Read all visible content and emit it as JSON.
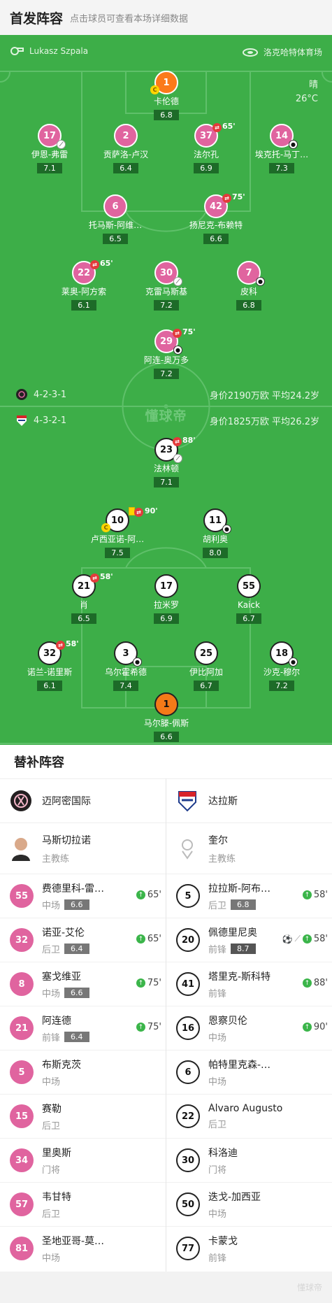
{
  "header": {
    "title": "首发阵容",
    "subtitle": "点击球员可查看本场详细数据"
  },
  "match": {
    "referee": "Lukasz Szpala",
    "venue": "洛克哈特体育场",
    "weather": "晴",
    "temp": "26°C"
  },
  "home": {
    "formation": "4-2-3-1",
    "value_text": "身价2190万欧 平均24.2岁"
  },
  "away": {
    "formation": "4-3-2-1",
    "value_text": "身价1825万欧 平均26.2岁"
  },
  "watermark": "懂球帝",
  "pitch_players": [
    {
      "num": "1",
      "name": "卡伦德",
      "rating": "6.8",
      "cap": "C"
    },
    {
      "num": "17",
      "name": "伊恩-弗雷",
      "rating": "7.1"
    },
    {
      "num": "2",
      "name": "贡萨洛-卢汉",
      "rating": "6.4"
    },
    {
      "num": "37",
      "name": "法尔孔",
      "rating": "6.9",
      "min": "65'"
    },
    {
      "num": "14",
      "name": "埃克托-马丁…",
      "rating": "7.3"
    },
    {
      "num": "6",
      "name": "托马斯-阿维…",
      "rating": "6.5"
    },
    {
      "num": "42",
      "name": "扬尼克-布赖特",
      "rating": "6.6",
      "min": "75'"
    },
    {
      "num": "22",
      "name": "莱奥-阿方索",
      "rating": "6.1",
      "min": "65'"
    },
    {
      "num": "30",
      "name": "克雷马斯基",
      "rating": "7.2"
    },
    {
      "num": "7",
      "name": "皮科",
      "rating": "6.8"
    },
    {
      "num": "29",
      "name": "阿连-奥万多",
      "rating": "7.2",
      "min": "75'"
    },
    {
      "num": "23",
      "name": "法林顿",
      "rating": "7.1",
      "min": "88'"
    },
    {
      "num": "10",
      "name": "卢西亚诺-阿…",
      "rating": "7.5",
      "min": "90'",
      "cap": "C"
    },
    {
      "num": "11",
      "name": "胡利奥",
      "rating": "8.0"
    },
    {
      "num": "21",
      "name": "肖",
      "rating": "6.5",
      "min": "58'"
    },
    {
      "num": "17",
      "name": "拉米罗",
      "rating": "6.9"
    },
    {
      "num": "55",
      "name": "Kaick",
      "rating": "6.7"
    },
    {
      "num": "32",
      "name": "诺兰-诺里斯",
      "rating": "6.1",
      "min": "58'"
    },
    {
      "num": "3",
      "name": "乌尔霍希德",
      "rating": "7.4"
    },
    {
      "num": "25",
      "name": "伊比阿加",
      "rating": "6.7"
    },
    {
      "num": "18",
      "name": "沙克-穆尔",
      "rating": "7.2"
    },
    {
      "num": "1",
      "name": "马尔滕-佩斯",
      "rating": "6.6"
    }
  ],
  "subs": {
    "title": "替补阵容",
    "home_team": "迈阿密国际",
    "away_team": "达拉斯",
    "home_coach": {
      "name": "马斯切拉诺",
      "role": "主教练"
    },
    "away_coach": {
      "name": "奎尔",
      "role": "主教练"
    },
    "home": [
      {
        "num": "55",
        "name": "费德里科-雷…",
        "pos": "中场",
        "rating": "6.6",
        "min": "65'"
      },
      {
        "num": "32",
        "name": "诺亚-艾伦",
        "pos": "后卫",
        "rating": "6.4",
        "min": "65'"
      },
      {
        "num": "8",
        "name": "塞戈维亚",
        "pos": "中场",
        "rating": "6.6",
        "min": "75'"
      },
      {
        "num": "21",
        "name": "阿连德",
        "pos": "前锋",
        "rating": "6.4",
        "min": "75'"
      },
      {
        "num": "5",
        "name": "布斯克茨",
        "pos": "中场"
      },
      {
        "num": "15",
        "name": "赛勒",
        "pos": "后卫"
      },
      {
        "num": "34",
        "name": "里奥斯",
        "pos": "门将"
      },
      {
        "num": "57",
        "name": "韦甘特",
        "pos": "后卫"
      },
      {
        "num": "81",
        "name": "圣地亚哥-莫…",
        "pos": "中场"
      }
    ],
    "away": [
      {
        "num": "5",
        "name": "拉拉斯-阿布…",
        "pos": "后卫",
        "rating": "6.8",
        "min": "58'"
      },
      {
        "num": "20",
        "name": "佩德里尼奥",
        "pos": "前锋",
        "rating": "8.7",
        "min": "58'"
      },
      {
        "num": "41",
        "name": "塔里克-斯科特",
        "pos": "前锋",
        "min": "88'"
      },
      {
        "num": "16",
        "name": "恩察贝伦",
        "pos": "中场",
        "min": "90'"
      },
      {
        "num": "6",
        "name": "帕特里克森-…",
        "pos": "中场"
      },
      {
        "num": "22",
        "name": "Álvaro Augusto",
        "pos": "后卫"
      },
      {
        "num": "30",
        "name": "科洛迪",
        "pos": "门将"
      },
      {
        "num": "50",
        "name": "迭戈-加西亚",
        "pos": "中场"
      },
      {
        "num": "77",
        "name": "卡蒙戈",
        "pos": "前锋"
      }
    ]
  },
  "colors": {
    "pitch": "#3dae48",
    "miami": "#e0649f",
    "gk_orange": "#fb7a1a",
    "sub_in": "#3bb54a"
  }
}
